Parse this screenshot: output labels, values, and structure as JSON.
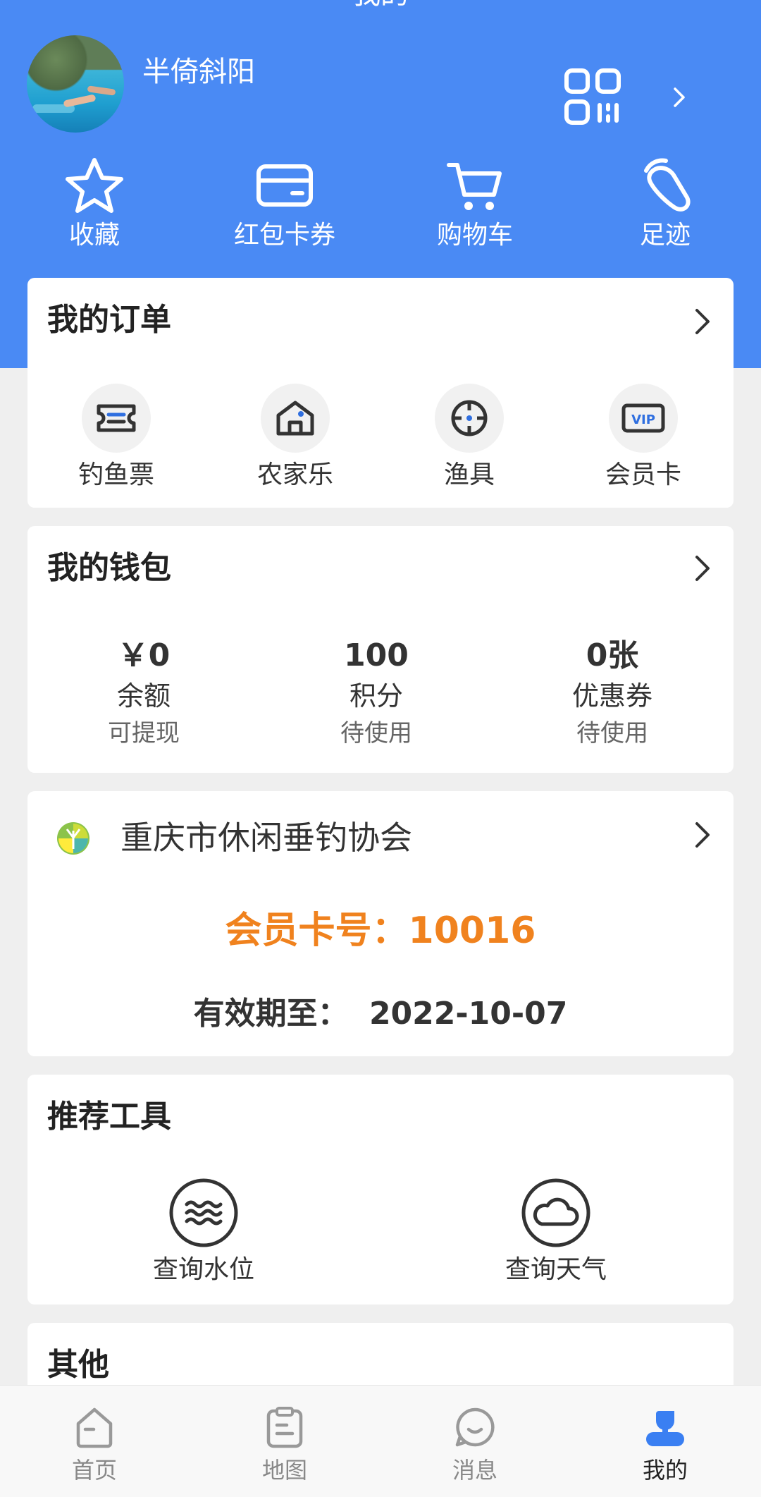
{
  "header": {
    "title": "我的",
    "username": "半倚斜阳"
  },
  "quick_links": [
    {
      "label": "收藏",
      "icon": "star-icon"
    },
    {
      "label": "红包卡券",
      "icon": "card-icon"
    },
    {
      "label": "购物车",
      "icon": "cart-icon"
    },
    {
      "label": "足迹",
      "icon": "footprint-icon"
    }
  ],
  "orders": {
    "title": "我的订单",
    "items": [
      {
        "label": "钓鱼票",
        "icon": "ticket-icon"
      },
      {
        "label": "农家乐",
        "icon": "house-icon"
      },
      {
        "label": "渔具",
        "icon": "target-icon"
      },
      {
        "label": "会员卡",
        "icon": "vip-icon"
      }
    ]
  },
  "wallet": {
    "title": "我的钱包",
    "items": [
      {
        "value": "￥0",
        "name": "余额",
        "sub": "可提现"
      },
      {
        "value": "100",
        "name": "积分",
        "sub": "待使用"
      },
      {
        "value": "0张",
        "name": "优惠券",
        "sub": "待使用"
      }
    ]
  },
  "association": {
    "name": "重庆市休闲垂钓协会",
    "card_no_label": "会员卡号：",
    "card_no": "10016",
    "expire_label": "有效期至：",
    "expire_date": "2022-10-07"
  },
  "tools": {
    "title": "推荐工具",
    "items": [
      {
        "label": "查询水位",
        "icon": "water-level-icon"
      },
      {
        "label": "查询天气",
        "icon": "weather-icon"
      }
    ]
  },
  "other": {
    "title": "其他"
  },
  "bottom_nav": [
    {
      "label": "首页",
      "icon": "home-icon",
      "active": false
    },
    {
      "label": "地图",
      "icon": "map-icon",
      "active": false
    },
    {
      "label": "消息",
      "icon": "message-icon",
      "active": false
    },
    {
      "label": "我的",
      "icon": "profile-icon",
      "active": true
    }
  ],
  "colors": {
    "header_blue": "#4a8af4",
    "accent_orange": "#f0821e",
    "nav_active": "#3a7ff2"
  }
}
